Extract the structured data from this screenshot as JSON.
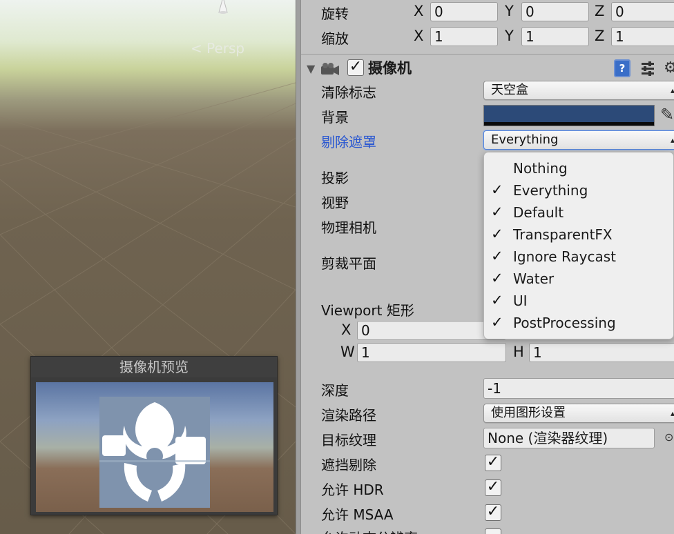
{
  "scene": {
    "persp_label": "Persp"
  },
  "camera_preview": {
    "title": "摄像机预览"
  },
  "transform": {
    "rotation": {
      "label": "旋转",
      "x": "0",
      "y": "0",
      "z": "0"
    },
    "scale": {
      "label": "缩放",
      "x": "1",
      "y": "1",
      "z": "1"
    },
    "axis_x": "X",
    "axis_y": "Y",
    "axis_z": "Z"
  },
  "camera": {
    "title": "摄像机",
    "enabled": "✓",
    "clear_flags": {
      "label": "清除标志",
      "value": "天空盒"
    },
    "background": {
      "label": "背景",
      "color": "#2c4a78"
    },
    "culling_mask": {
      "label": "剔除遮罩",
      "value": "Everything"
    },
    "projection": {
      "label": "投影"
    },
    "fov": {
      "label": "视野"
    },
    "physical_camera": {
      "label": "物理相机"
    },
    "clipping_planes": {
      "label": "剪裁平面"
    },
    "viewport": {
      "label": "Viewport 矩形",
      "x_axis": "X",
      "x": "0",
      "w_axis": "W",
      "w": "1",
      "h_axis": "H",
      "h": "1"
    },
    "depth": {
      "label": "深度",
      "value": "-1"
    },
    "rendering_path": {
      "label": "渲染路径",
      "value": "使用图形设置"
    },
    "target_texture": {
      "label": "目标纹理",
      "value": "None (渲染器纹理)"
    },
    "occlusion_culling": {
      "label": "遮挡剔除",
      "check": "✓"
    },
    "allow_hdr": {
      "label": "允许 HDR",
      "check": "✓"
    },
    "allow_msaa": {
      "label": "允许 MSAA",
      "check": "✓"
    },
    "allow_dynamic_resolution": {
      "label": "允许动态分辨率"
    },
    "help_icon_glyph": "?",
    "gear_icon_glyph": "⚙"
  },
  "culling_popup": {
    "items": [
      {
        "label": "Nothing",
        "check": ""
      },
      {
        "label": "Everything",
        "check": "✓"
      },
      {
        "label": "Default",
        "check": "✓"
      },
      {
        "label": "TransparentFX",
        "check": "✓"
      },
      {
        "label": "Ignore Raycast",
        "check": "✓"
      },
      {
        "label": "Water",
        "check": "✓"
      },
      {
        "label": "UI",
        "check": "✓"
      },
      {
        "label": "PostProcessing",
        "check": "✓"
      }
    ]
  },
  "icons": {
    "fold": "fold-arrow-icon",
    "camera": "camera-icon",
    "help": "help-book-icon",
    "presets": "presets-icon",
    "gear": "gear-icon",
    "eyedropper": "eyedropper-icon",
    "object_picker": "object-picker-icon",
    "dropdown": "dropdown-arrows-icon",
    "biohazard": "biohazard-icon"
  }
}
